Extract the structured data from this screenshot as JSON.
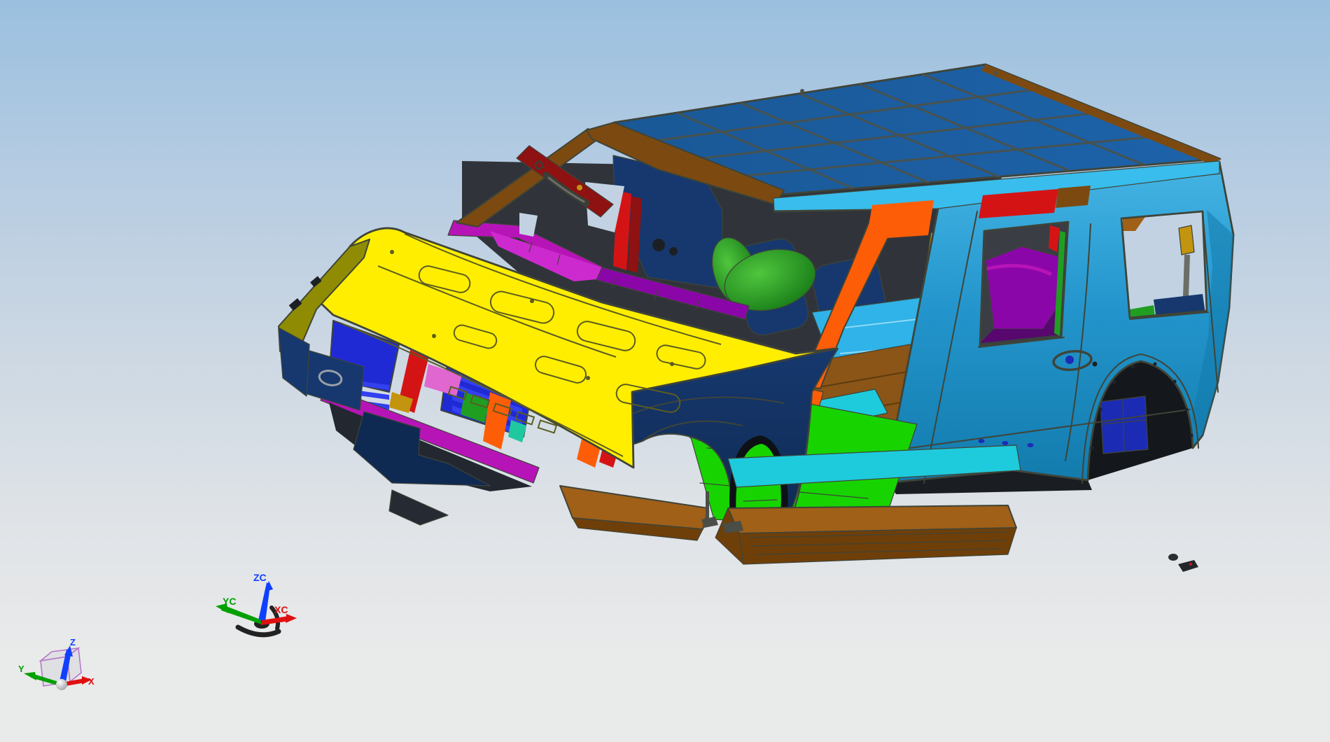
{
  "viewport": {
    "triad_absolute": {
      "x_label": "X",
      "y_label": "Y",
      "z_label": "Z"
    },
    "triad_wcs": {
      "x_label": "XC",
      "y_label": "YC",
      "z_label": "ZC"
    }
  },
  "colors": {
    "bg_top": "#9ac0df",
    "bg_mid1": "#b4cbe2",
    "bg_mid2": "#cdd8e3",
    "bg_low": "#dfe3e7",
    "bg_bottom": "#e9eaea",
    "line": "#3f4438",
    "roof": "#1a5896",
    "roof_hi": "#1d63aa",
    "roof_line": "#4d5147",
    "rail": "#38bdec",
    "body_hi": "#45b5e4",
    "body_mid": "#2395cc",
    "body_lo": "#127aab",
    "hood": "#ffee00",
    "hood_line": "#5c5c20",
    "fender_olive": "#8f8c04",
    "navy": "#16386e",
    "navy_dark": "#0f2a52",
    "grille_blue": "#1f2ad4",
    "slat_blue": "#3340f0",
    "magenta": "#b714b7",
    "purple": "#8a06a8",
    "purple_dark": "#57076e",
    "orange": "#fe5d07",
    "red": "#d41414",
    "dark_red": "#8e1212",
    "brown": "#7c4a10",
    "copper": "#a06018",
    "copper_dark": "#6f3f09",
    "floor_brown": "#8a5517",
    "green": "#17d400",
    "green_mid": "#1f9e22",
    "green_dark": "#117312",
    "floor_blue": "#2fb3e8",
    "cyan": "#1ecbdc",
    "gold": "#c3940e",
    "olive_strip": "#b5b200",
    "royal": "#1b2bb4",
    "pink": "#e066d0",
    "teal": "#20c8a0",
    "sky_hole": "#c2d2e2",
    "shadow": "#1c2024",
    "steel": "#555952",
    "cabin_base": "#30343a",
    "axis_red": "#e01010",
    "axis_green": "#00a000",
    "axis_blue": "#1040ff",
    "cube_purple": "#b678c8",
    "wcs_dark": "#222222"
  }
}
